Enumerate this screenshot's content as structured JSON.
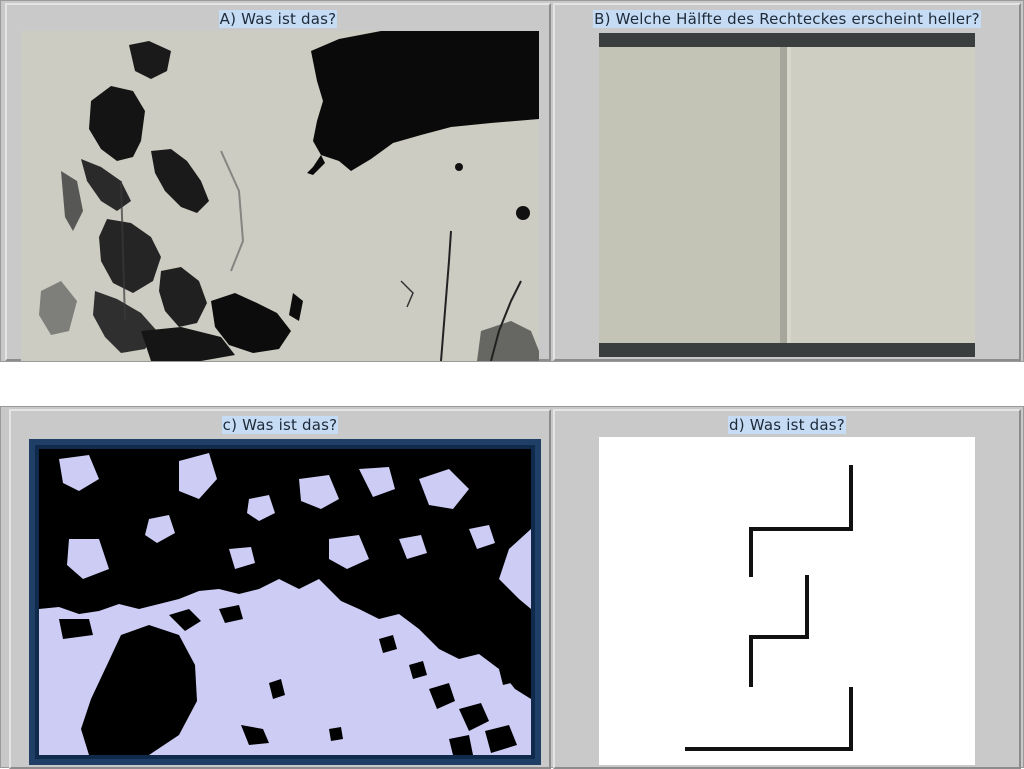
{
  "panels": [
    {
      "caption": "A) Was ist das?"
    },
    {
      "caption": "B) Welche Hälfte des Rechteckes erscheint heller?"
    },
    {
      "caption": "c) Was ist das?"
    },
    {
      "caption": "d) Was ist das?"
    }
  ],
  "colors": {
    "table_bg": "#c8c8c8",
    "caption_highlight": "#c6dcf5",
    "panel_c_background": "#ccccf5",
    "panel_c_frame": "#1f3f66",
    "panel_b_band": "#3a3e3e"
  }
}
